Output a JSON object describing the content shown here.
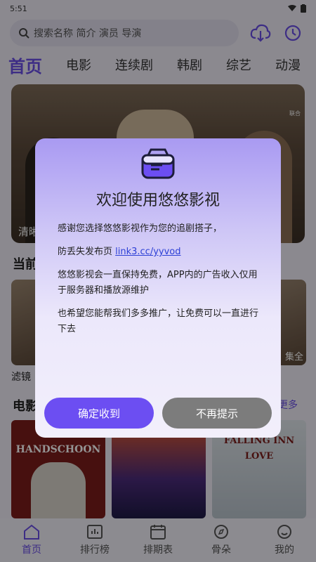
{
  "status_bar": {
    "time": "5:51"
  },
  "search": {
    "placeholder": "搜索名称 简介 演员 导演"
  },
  "tabs": [
    {
      "label": "首页",
      "active": true
    },
    {
      "label": "电影"
    },
    {
      "label": "连续剧"
    },
    {
      "label": "韩剧"
    },
    {
      "label": "综艺"
    },
    {
      "label": "动漫"
    }
  ],
  "banner": {
    "caption": "清晰",
    "badge": "联合"
  },
  "sections": {
    "current_title": "当前",
    "thumb_caption": "滤镜",
    "thumb_corner": "集全",
    "movies_title": "电影",
    "more": "更多"
  },
  "posters": [
    {
      "title": "HANDSCHOON",
      "subtitle": "",
      "bg": "#7a1d1a"
    },
    {
      "title": "",
      "subtitle": "",
      "bg": "#3a2a6a"
    },
    {
      "title": "FALLING INN",
      "subtitle": "LOVE",
      "bg": "#cfd7e0"
    }
  ],
  "dialog": {
    "title": "欢迎使用悠悠影视",
    "p1": "感谢您选择悠悠影视作为您的追剧搭子，",
    "p2_prefix": "防丢失发布页 ",
    "p2_link": "link3.cc/yyvod",
    "p3": "悠悠影视会一直保持免费，APP内的广告收入仅用于服务器和播放源维护",
    "p4": "也希望您能帮我们多多推广，让免费可以一直进行下去",
    "confirm_label": "确定收到",
    "dismiss_label": "不再提示"
  },
  "bottom_nav": [
    {
      "label": "首页",
      "icon": "home-icon",
      "active": true
    },
    {
      "label": "排行榜",
      "icon": "chart-icon"
    },
    {
      "label": "排期表",
      "icon": "calendar-icon"
    },
    {
      "label": "骨朵",
      "icon": "compass-icon"
    },
    {
      "label": "我的",
      "icon": "smile-icon"
    }
  ],
  "colors": {
    "accent": "#6a4ee5",
    "confirm": "#6c4ef2",
    "dismiss": "#7c7c7c"
  }
}
